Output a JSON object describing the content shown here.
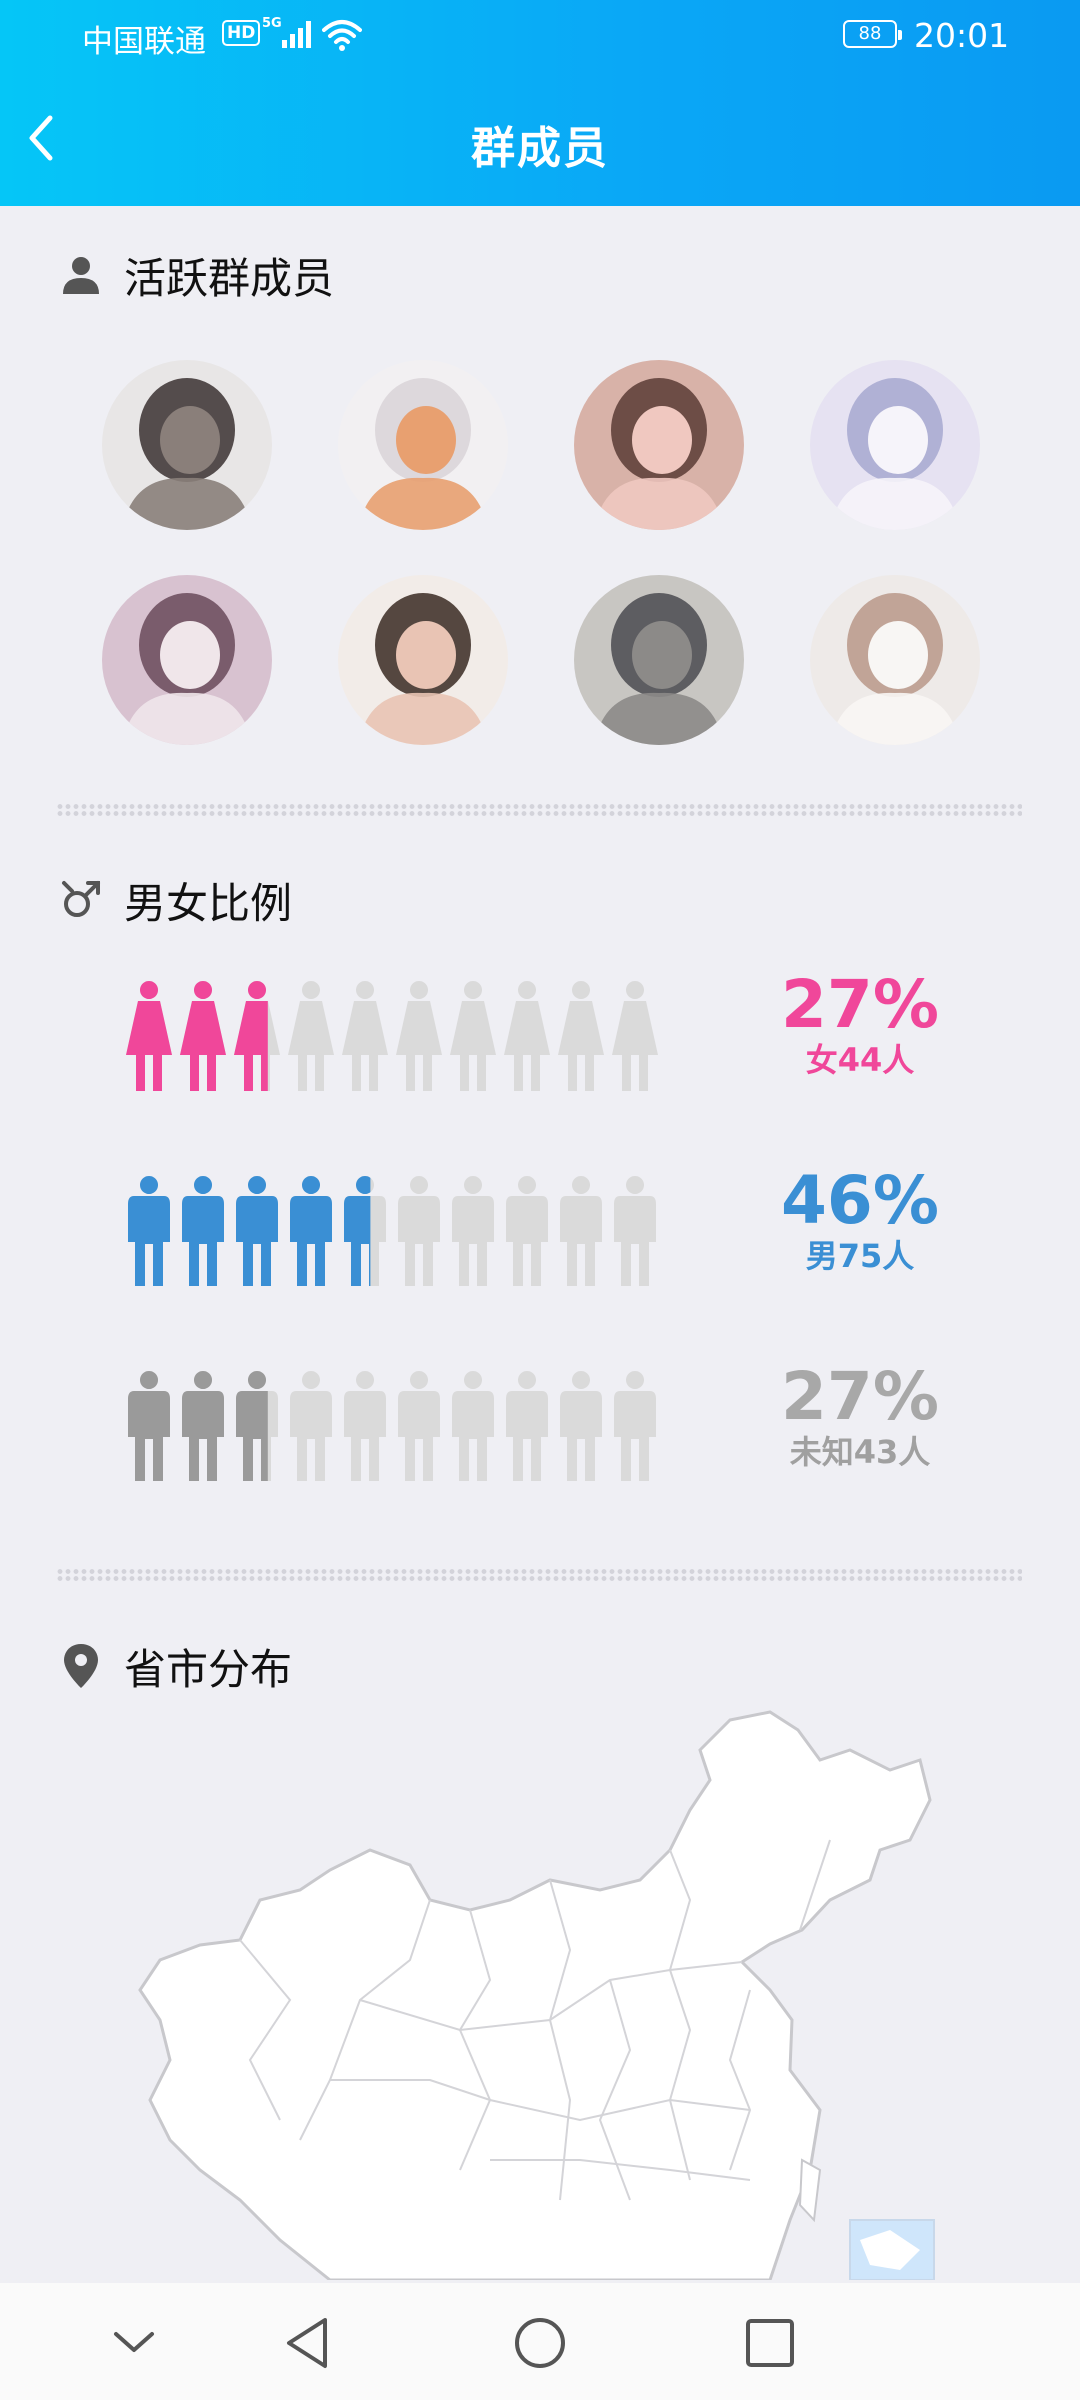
{
  "status_bar": {
    "carrier": "中国联通",
    "hd": "HD",
    "network": "5G",
    "battery": "88",
    "time": "20:01"
  },
  "header": {
    "title": "群成员"
  },
  "active_members": {
    "title": "活跃群成员",
    "avatars": [
      {
        "colors": [
          "#e8e6e6",
          "#3a3030",
          "#8a7f7a"
        ]
      },
      {
        "colors": [
          "#f2f0f2",
          "#d9d4d8",
          "#e8a070"
        ]
      },
      {
        "colors": [
          "#d8b2a8",
          "#5a3b35",
          "#f0c8c0"
        ]
      },
      {
        "colors": [
          "#e6e2f2",
          "#a6a8d0",
          "#f6f4fa"
        ]
      },
      {
        "colors": [
          "#d8c2d0",
          "#6a4a5a",
          "#f0e6ea"
        ]
      },
      {
        "colors": [
          "#f2ece8",
          "#3a2a22",
          "#e9c4b4"
        ]
      },
      {
        "colors": [
          "#c8c6c2",
          "#4a4a50",
          "#8c8a88"
        ]
      },
      {
        "colors": [
          "#eeeae8",
          "#b89888",
          "#f8f6f4"
        ]
      }
    ]
  },
  "gender_ratio": {
    "title": "男女比例",
    "rows": [
      {
        "kind": "female",
        "percent": "27%",
        "label": "女",
        "count": "44",
        "unit": "人",
        "fraction": 0.27,
        "color": "#f0479a"
      },
      {
        "kind": "male",
        "percent": "46%",
        "label": "男",
        "count": "75",
        "unit": "人",
        "fraction": 0.46,
        "color": "#3a8fd4"
      },
      {
        "kind": "unknown",
        "percent": "27%",
        "label": "未知",
        "count": "43",
        "unit": "人",
        "fraction": 0.27,
        "color": "#9a9a9a"
      }
    ]
  },
  "province": {
    "title": "省市分布"
  },
  "navbar": {
    "back": "back",
    "home": "home",
    "recents": "recents",
    "collapse": "collapse"
  }
}
